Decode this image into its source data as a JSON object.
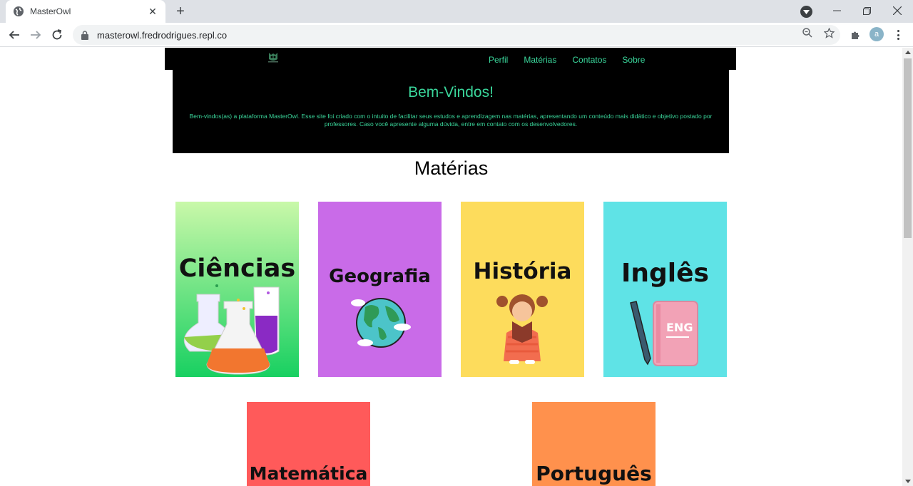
{
  "browser": {
    "tab_title": "MasterOwl",
    "url": "masterowl.fredrodrigues.repl.co",
    "profile_initial": "a"
  },
  "site": {
    "nav": [
      "Perfil",
      "Matérias",
      "Contatos",
      "Sobre"
    ],
    "hero_title": "Bem-Vindos!",
    "hero_text": "Bem-vindos(as) a plataforma MasterOwl. Esse site foi criado com o intuito de facilitar seus estudos e aprendizagem nas matérias, apresentando um conteúdo mais didático e objetivo postado por professores. Caso você apresente alguma dúvida, entre em contato com os desenvolvedores.",
    "section_title": "Matérias",
    "subjects": [
      {
        "label": "Ciências",
        "color": "#3bd26d"
      },
      {
        "label": "Geografia",
        "color": "#c96be8"
      },
      {
        "label": "História",
        "color": "#fddc5c"
      },
      {
        "label": "Inglês",
        "color": "#5fe3e6"
      },
      {
        "label": "Matemática",
        "color": "#ff5a5a"
      },
      {
        "label": "Português",
        "color": "#ff914d"
      }
    ]
  }
}
